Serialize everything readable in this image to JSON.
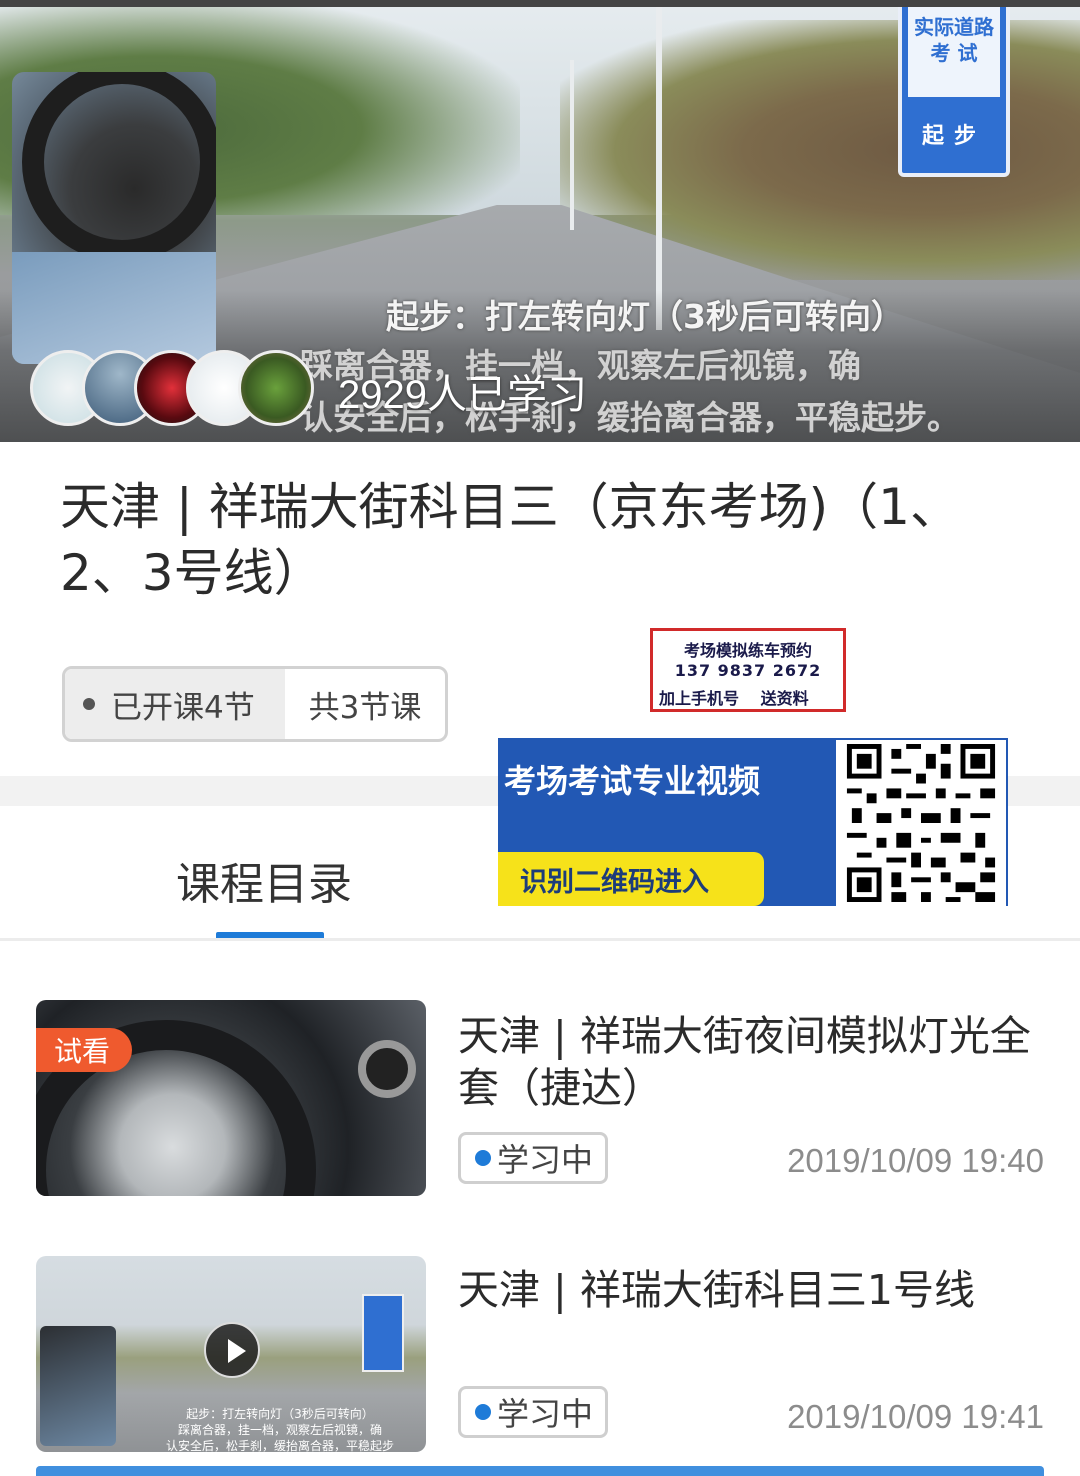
{
  "hero": {
    "sign_top_line1": "实际道路",
    "sign_top_line2": "考 试",
    "sign_bottom": "起步",
    "caption_main": "起步：打左转向灯（3秒后可转向）",
    "caption_detail": "踩离合器，挂一档，观察左后视镜，确\n认安全后，松手刹，缓抬离合器，平稳起步。",
    "learned_count": "2929人已学习",
    "avatar_colors": [
      "#d7e6ea",
      "#6b8aa6",
      "#c0141e",
      "#e8edef",
      "#4c7a32"
    ]
  },
  "course": {
    "title": "天津 | 祥瑞大街科目三（京东考场)（1、2、3号线）",
    "opened_label": "已开课4节",
    "total_label": "共3节课"
  },
  "promo": {
    "line1": "考场模拟练车预约",
    "line2": "137 9837 2672",
    "line3": "加上手机号 送资料"
  },
  "banner": {
    "title": "考场考试专业视频",
    "button": "识别二维码进入",
    "accent": "#2258b4",
    "button_color": "#f6e21a"
  },
  "tabs": {
    "catalog": "课程目录",
    "accent": "#1e7bd8"
  },
  "lessons": [
    {
      "tag": "试看",
      "title": "天津 | 祥瑞大街夜间模拟灯光全套（捷达）",
      "status": "学习中",
      "time": "2019/10/09 19:40"
    },
    {
      "title": "天津 | 祥瑞大街科目三1号线",
      "status": "学习中",
      "time": "2019/10/09 19:41",
      "thumb_caption": "起步：打左转向灯（3秒后可转向）\n踩离合器，挂一档，观察左后视镜，确\n认安全后，松手刹，缓抬离合器，平稳起步"
    }
  ]
}
